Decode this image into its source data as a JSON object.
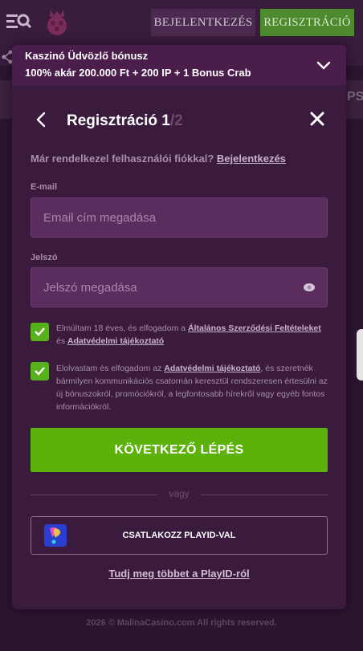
{
  "header": {
    "login_label": "BEJELENTKEZÉS",
    "register_label": "REGISZTRÁCIÓ"
  },
  "background": {
    "side_text": "PS",
    "footer_copy": "2026 © MalinaCasino.com All rights reserved."
  },
  "promo": {
    "title": "Kaszinó Üdvözlő bónusz",
    "subtitle": "100% akár 200.000 Ft + 200 IP + 1 Bonus Crab"
  },
  "modal": {
    "title": "Regisztráció ",
    "step_current": "1",
    "step_total": "/2",
    "have_account_text": "Már rendelkezel felhasználói fiókkal? ",
    "login_link": "Bejelentkezés",
    "email_label": "E-mail",
    "email_placeholder": "Email cím megadása",
    "email_value": "",
    "password_label": "Jelszó",
    "password_placeholder": "Jelszó megadása",
    "password_value": "",
    "consent1": {
      "checked": true,
      "text_a": "Elmúltam 18 éves, és elfogadom a ",
      "link_a": "Általános Szerződési Feltételeket",
      "text_b": " és ",
      "link_b": "Adatvédelmi tájékoztató"
    },
    "consent2": {
      "checked": true,
      "text_a": "Elolvastam és elfogadom az ",
      "link_a": "Adatvédelmi tájékoztató",
      "text_b": ", és szeretnék bármilyen kommunikációs csatornán keresztül rendszeresen értesülni az új bónuszokról, promóciókról, a legfontosabb hírekről vagy egyéb fontos információkról."
    },
    "next_button": "KÖVETKEZŐ LÉPÉS",
    "divider": "vagy",
    "playid_button": "CSATLAKOZZ PLAYID-VAL",
    "learn_more": "Tudj meg többet a PlayID-ról"
  },
  "colors": {
    "accent_green": "#5cb20a",
    "modal_bg": "#3a1a3d",
    "input_bg": "#5a2d5e"
  }
}
